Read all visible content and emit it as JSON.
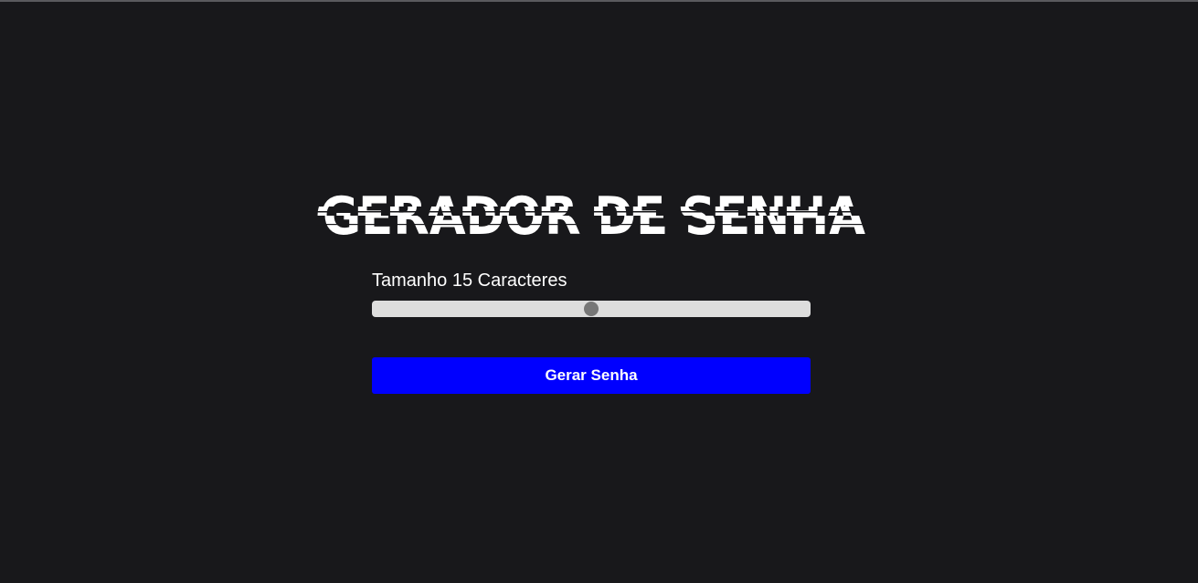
{
  "app": {
    "title": "GERADOR DE SENHA"
  },
  "length_control": {
    "label": "Tamanho 15 Caracteres",
    "value": 15,
    "fill_fraction": 0.5
  },
  "actions": {
    "generate_label": "Gerar Senha"
  },
  "colors": {
    "background": "#18181b",
    "title": "#ffffff",
    "label": "#ffffff",
    "slider_track": "#dddddd",
    "slider_thumb": "#777777",
    "button": "#0000ff",
    "button_text": "#ffffff"
  }
}
